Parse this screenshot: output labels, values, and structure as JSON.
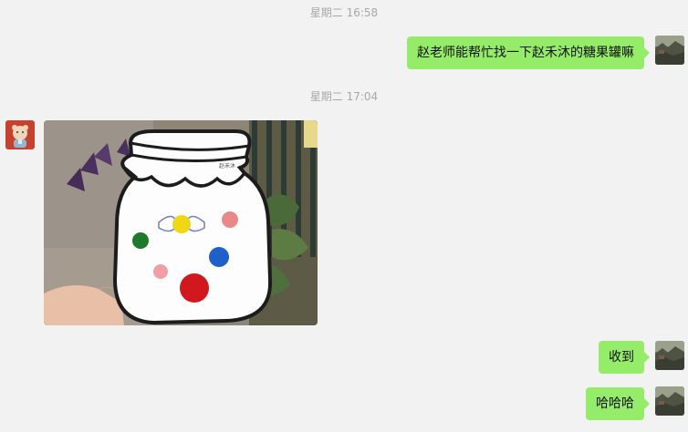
{
  "timestamps": {
    "first": "星期二 16:58",
    "second": "星期二 17:04"
  },
  "messages": [
    {
      "side": "right",
      "type": "text",
      "text": "赵老师能帮忙找一下赵禾沐的糖果罐嘛"
    },
    {
      "side": "left",
      "type": "image",
      "image": "candy-jar-artwork-photo",
      "label": "赵禾沐"
    },
    {
      "side": "right",
      "type": "text",
      "text": "收到"
    },
    {
      "side": "right",
      "type": "text",
      "text": "哈哈哈"
    }
  ],
  "avatars": {
    "self": "self-avatar-landscape",
    "contact": "contact-avatar-cartoon"
  },
  "colors": {
    "background": "#f2f2f2",
    "bubble_self": "#95ec69",
    "timestamp": "#a8a8a8"
  }
}
